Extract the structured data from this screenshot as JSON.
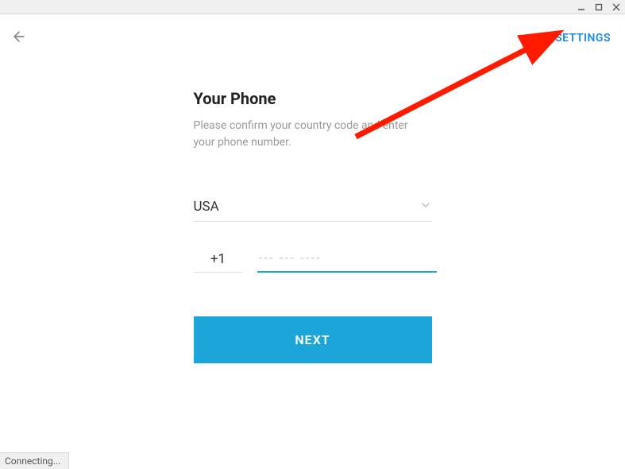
{
  "header": {
    "settings_label": "SETTINGS"
  },
  "form": {
    "title": "Your Phone",
    "subtitle": "Please confirm your country code and enter your phone number.",
    "country": "USA",
    "dial_code": "+1",
    "phone_placeholder": "--- --- ----",
    "next_label": "NEXT"
  },
  "status": {
    "text": "Connecting..."
  },
  "colors": {
    "accent_link": "#1e88e5",
    "accent_button": "#1ca5d9",
    "annotation": "#ff1a00"
  }
}
